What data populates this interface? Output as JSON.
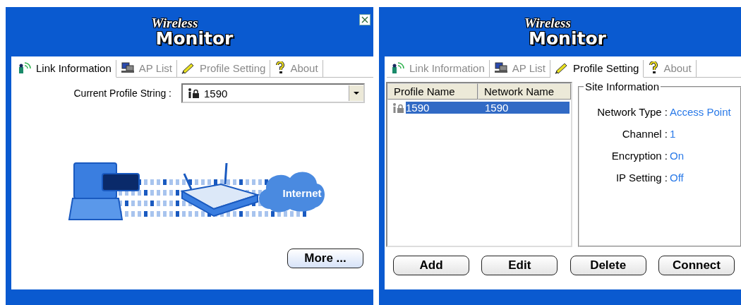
{
  "windows": [
    {
      "kind": "link",
      "logo": {
        "line_1": "Wireless",
        "line_2": "Monitor"
      },
      "tabs": [
        {
          "label": "Link Information",
          "selected": true
        },
        {
          "label": "AP List",
          "selected": false
        },
        {
          "label": "Profile Setting",
          "selected": false
        },
        {
          "label": "About",
          "selected": false
        }
      ],
      "profile_field": {
        "label": "Current Profile String :",
        "value": "1590"
      },
      "illustration": {
        "label": "Internet"
      },
      "buttons": [
        "More ..."
      ]
    },
    {
      "kind": "profile",
      "logo": {
        "line_1": "Wireless",
        "line_2": "Monitor"
      },
      "tabs": [
        {
          "label": "Link Information",
          "selected": false
        },
        {
          "label": "AP List",
          "selected": false
        },
        {
          "label": "Profile Setting",
          "selected": true
        },
        {
          "label": "About",
          "selected": false
        }
      ],
      "profile_table": {
        "columns": [
          "Profile Name",
          "Network Name"
        ],
        "rows": [
          {
            "cells": [
              "1590",
              "1590"
            ],
            "selected": true
          }
        ]
      },
      "site_information": {
        "title": "Site Information",
        "fields": [
          {
            "label": "Network Type :",
            "value": "Access Point"
          },
          {
            "label": "Channel :",
            "value": "1"
          },
          {
            "label": "Encryption :",
            "value": "On"
          },
          {
            "label": "IP Setting :",
            "value": "Off"
          }
        ]
      },
      "buttons": [
        "Add",
        "Edit",
        "Delete",
        "Connect"
      ]
    }
  ]
}
